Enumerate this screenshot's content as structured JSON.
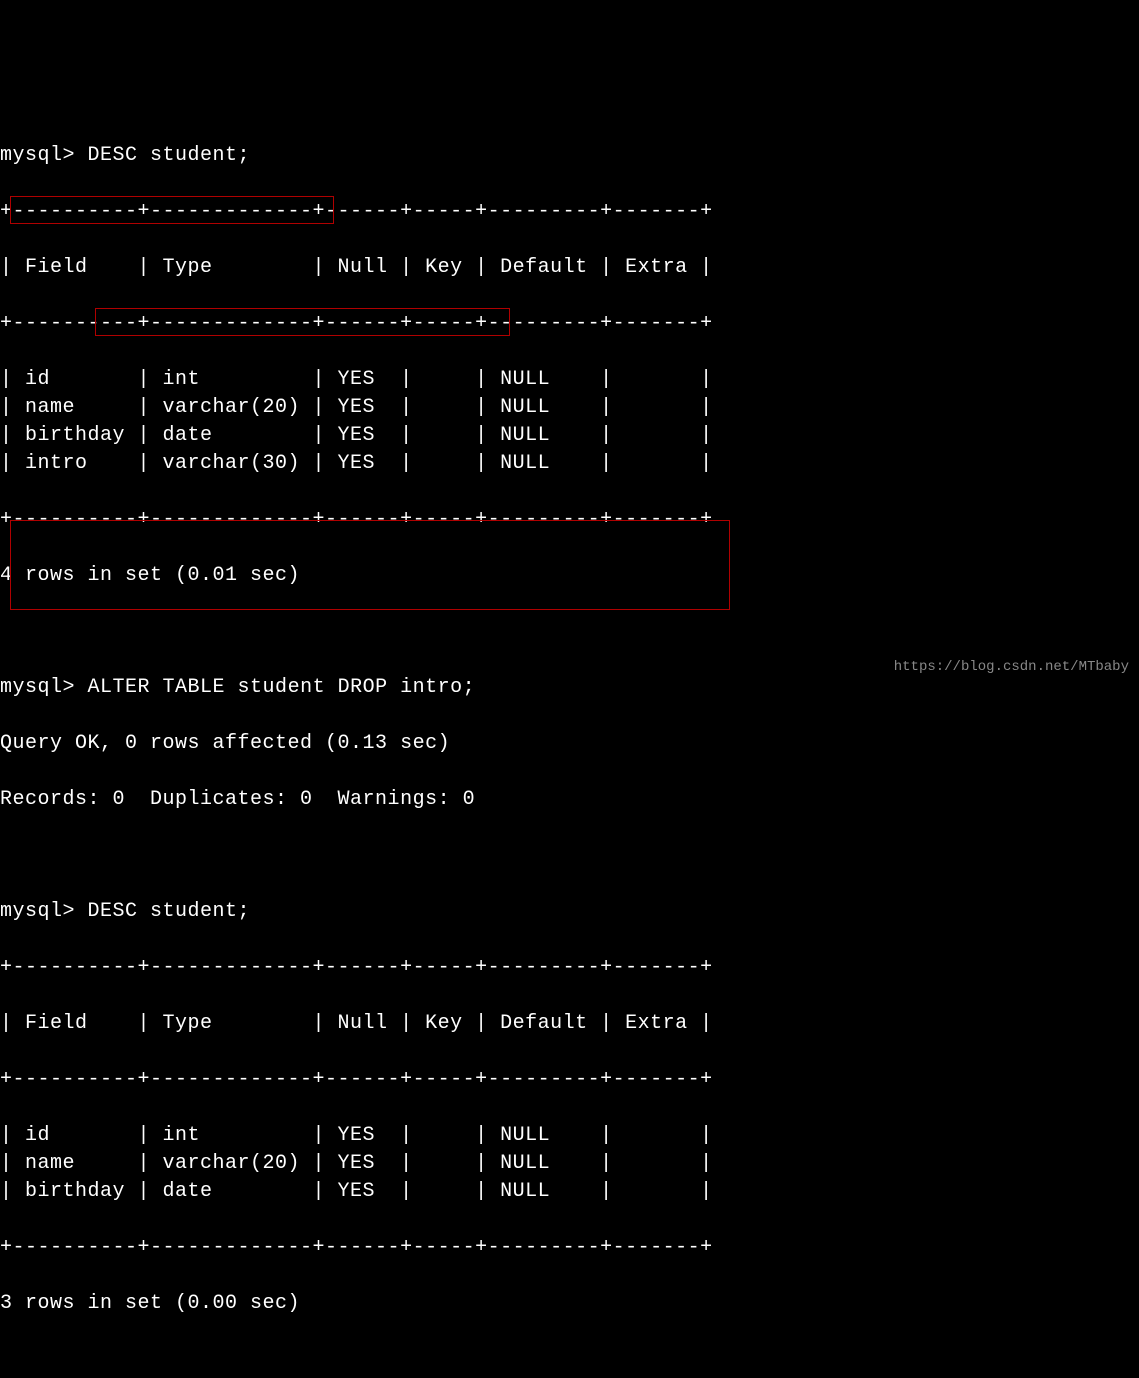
{
  "prompt": "mysql>",
  "commands": {
    "desc1": "DESC student;",
    "alter": "ALTER TABLE student DROP intro;",
    "desc2": "DESC student;"
  },
  "results": {
    "query_ok": "Query OK, 0 rows affected (0.13 sec)",
    "records_line": "Records: 0  Duplicates: 0  Warnings: 0",
    "rows1": "4 rows in set (0.01 sec)",
    "rows2": "3 rows in set (0.00 sec)"
  },
  "headers": [
    "Field",
    "Type",
    "Null",
    "Key",
    "Default",
    "Extra"
  ],
  "table1": {
    "rows": [
      {
        "field": "id",
        "type": "int",
        "null": "YES",
        "key": "",
        "default": "NULL",
        "extra": ""
      },
      {
        "field": "name",
        "type": "varchar(20)",
        "null": "YES",
        "key": "",
        "default": "NULL",
        "extra": ""
      },
      {
        "field": "birthday",
        "type": "date",
        "null": "YES",
        "key": "",
        "default": "NULL",
        "extra": ""
      },
      {
        "field": "intro",
        "type": "varchar(30)",
        "null": "YES",
        "key": "",
        "default": "NULL",
        "extra": ""
      }
    ]
  },
  "table2": {
    "rows": [
      {
        "field": "id",
        "type": "int",
        "null": "YES",
        "key": "",
        "default": "NULL",
        "extra": ""
      },
      {
        "field": "name",
        "type": "varchar(20)",
        "null": "YES",
        "key": "",
        "default": "NULL",
        "extra": ""
      },
      {
        "field": "birthday",
        "type": "date",
        "null": "YES",
        "key": "",
        "default": "NULL",
        "extra": ""
      }
    ]
  },
  "watermark": "https://blog.csdn.net/MTbaby",
  "border_chars": {
    "sep": "+----------+-------------+------+-----+---------+-------+"
  },
  "col_widths": {
    "field": 10,
    "type": 13,
    "null": 6,
    "key": 5,
    "default": 9,
    "extra": 7
  }
}
